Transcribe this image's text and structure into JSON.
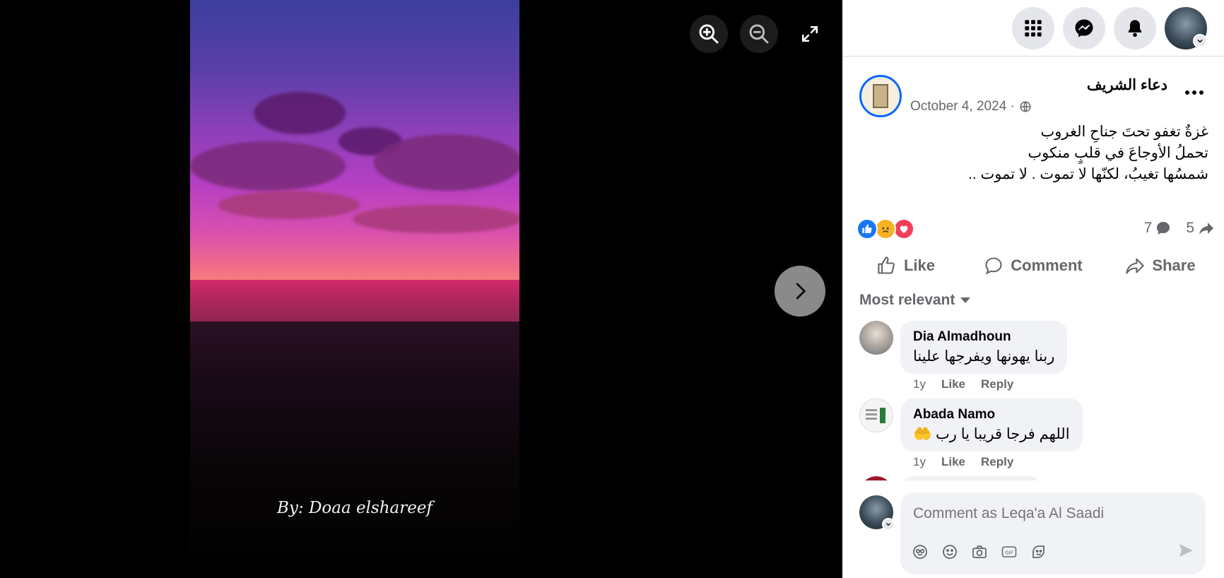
{
  "viewer": {
    "caption": "By: Doaa elshareef",
    "tools": [
      "zoom-in",
      "zoom-out",
      "fullscreen"
    ]
  },
  "topbar": {
    "icons": [
      "grid-menu-icon",
      "messenger-icon",
      "notifications-bell-icon",
      "account-avatar"
    ]
  },
  "post": {
    "author": "دعاء الشريف",
    "date": "October 4, 2024 ·",
    "privacy": "public-globe-icon",
    "text_lines": [
      "غزةٌ تغفو تحتَ جناحِ الغروب",
      "تحملُ الأوجاعَ في قلبٍ منكوب",
      "شمسُها تغيبُ، لكنّها لا تموت . لا تموت .."
    ],
    "reactions": [
      "like",
      "sad",
      "love"
    ],
    "comment_count": "7",
    "share_count": "5"
  },
  "actions": {
    "like": "Like",
    "comment": "Comment",
    "share": "Share"
  },
  "comments_sort": "Most relevant",
  "comments": [
    {
      "name": "Dia Almadhoun",
      "text": "ربنا يهونها ويفرجها علينا",
      "time": "1y",
      "like": "Like",
      "reply": "Reply"
    },
    {
      "name": "Abada Namo",
      "text": "اللهم فرجا قريبا يا رب 🤲",
      "time": "1y",
      "like": "Like",
      "reply": "Reply"
    }
  ],
  "composer": {
    "placeholder": "Comment as Leqa'a Al Saadi",
    "icons": [
      "avatar-sticker-icon",
      "emoji-icon",
      "camera-icon",
      "gif-icon",
      "sticker-icon",
      "send-icon"
    ]
  },
  "colors": {
    "accent": "#0866ff",
    "like_blue": "#1877f2",
    "love_red": "#f33e58",
    "sad_yellow": "#f7b125",
    "secondary_text": "#65676b"
  }
}
